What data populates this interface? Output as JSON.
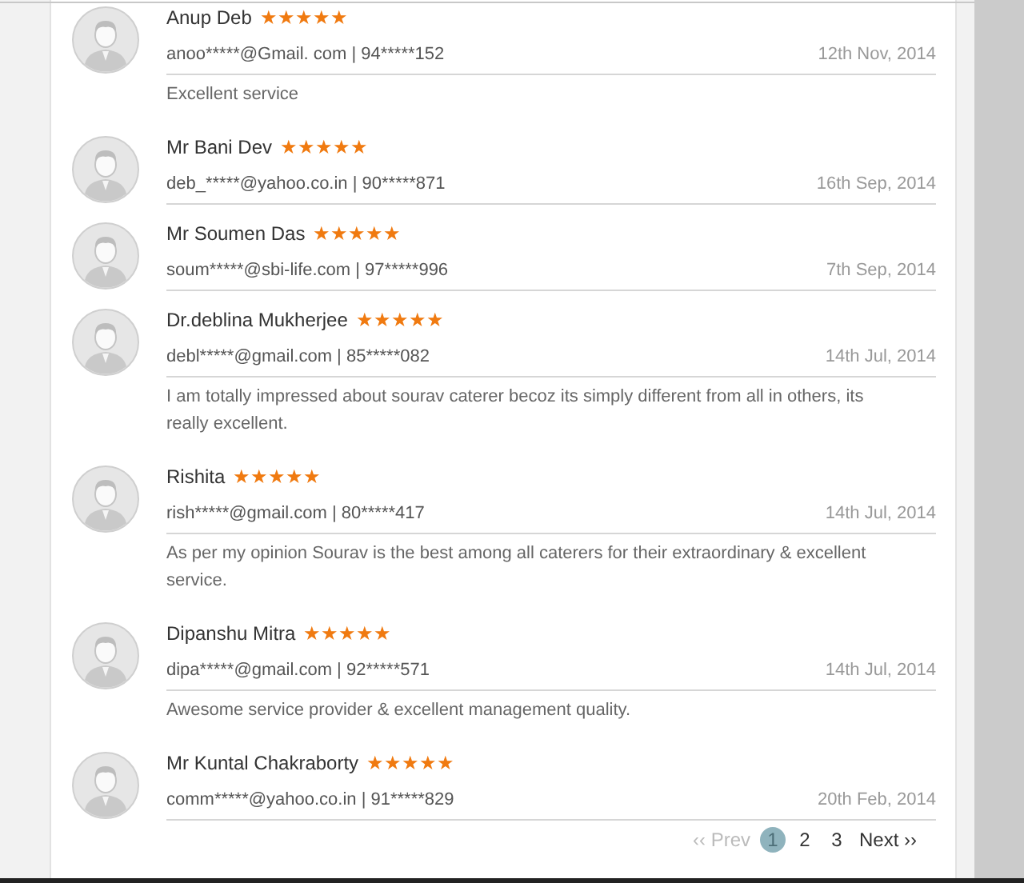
{
  "reviews": [
    {
      "name": "Anup Deb",
      "stars": 5,
      "contact": "anoo*****@Gmail. com | 94*****152",
      "date": "12th Nov, 2014",
      "comment": "Excellent service"
    },
    {
      "name": "Mr Bani Dev",
      "stars": 5,
      "contact": "deb_*****@yahoo.co.in | 90*****871",
      "date": "16th Sep, 2014"
    },
    {
      "name": "Mr Soumen Das",
      "stars": 5,
      "contact": "soum*****@sbi-life.com | 97*****996",
      "date": "7th Sep, 2014"
    },
    {
      "name": "Dr.deblina Mukherjee",
      "stars": 5,
      "contact": "debl*****@gmail.com | 85*****082",
      "date": "14th Jul, 2014",
      "comment": "I am totally impressed about sourav caterer becoz its simply different from all in others, its really excellent."
    },
    {
      "name": "Rishita",
      "stars": 5,
      "contact": "rish*****@gmail.com | 80*****417",
      "date": "14th Jul, 2014",
      "comment": "As per my opinion Sourav is the best among all caterers for their extraordinary & excellent service."
    },
    {
      "name": "Dipanshu Mitra",
      "stars": 5,
      "contact": "dipa*****@gmail.com | 92*****571",
      "date": "14th Jul, 2014",
      "comment": "Awesome service provider & excellent management quality."
    },
    {
      "name": "Mr Kuntal Chakraborty",
      "stars": 5,
      "contact": "comm*****@yahoo.co.in | 91*****829",
      "date": "20th Feb, 2014"
    }
  ],
  "pagination": {
    "prev": {
      "label": "‹‹ Prev",
      "disabled": true
    },
    "pages": [
      {
        "label": "1",
        "selected": true
      },
      {
        "label": "2",
        "selected": false
      },
      {
        "label": "3",
        "selected": false
      }
    ],
    "next": {
      "label": "Next ››",
      "disabled": false
    }
  }
}
